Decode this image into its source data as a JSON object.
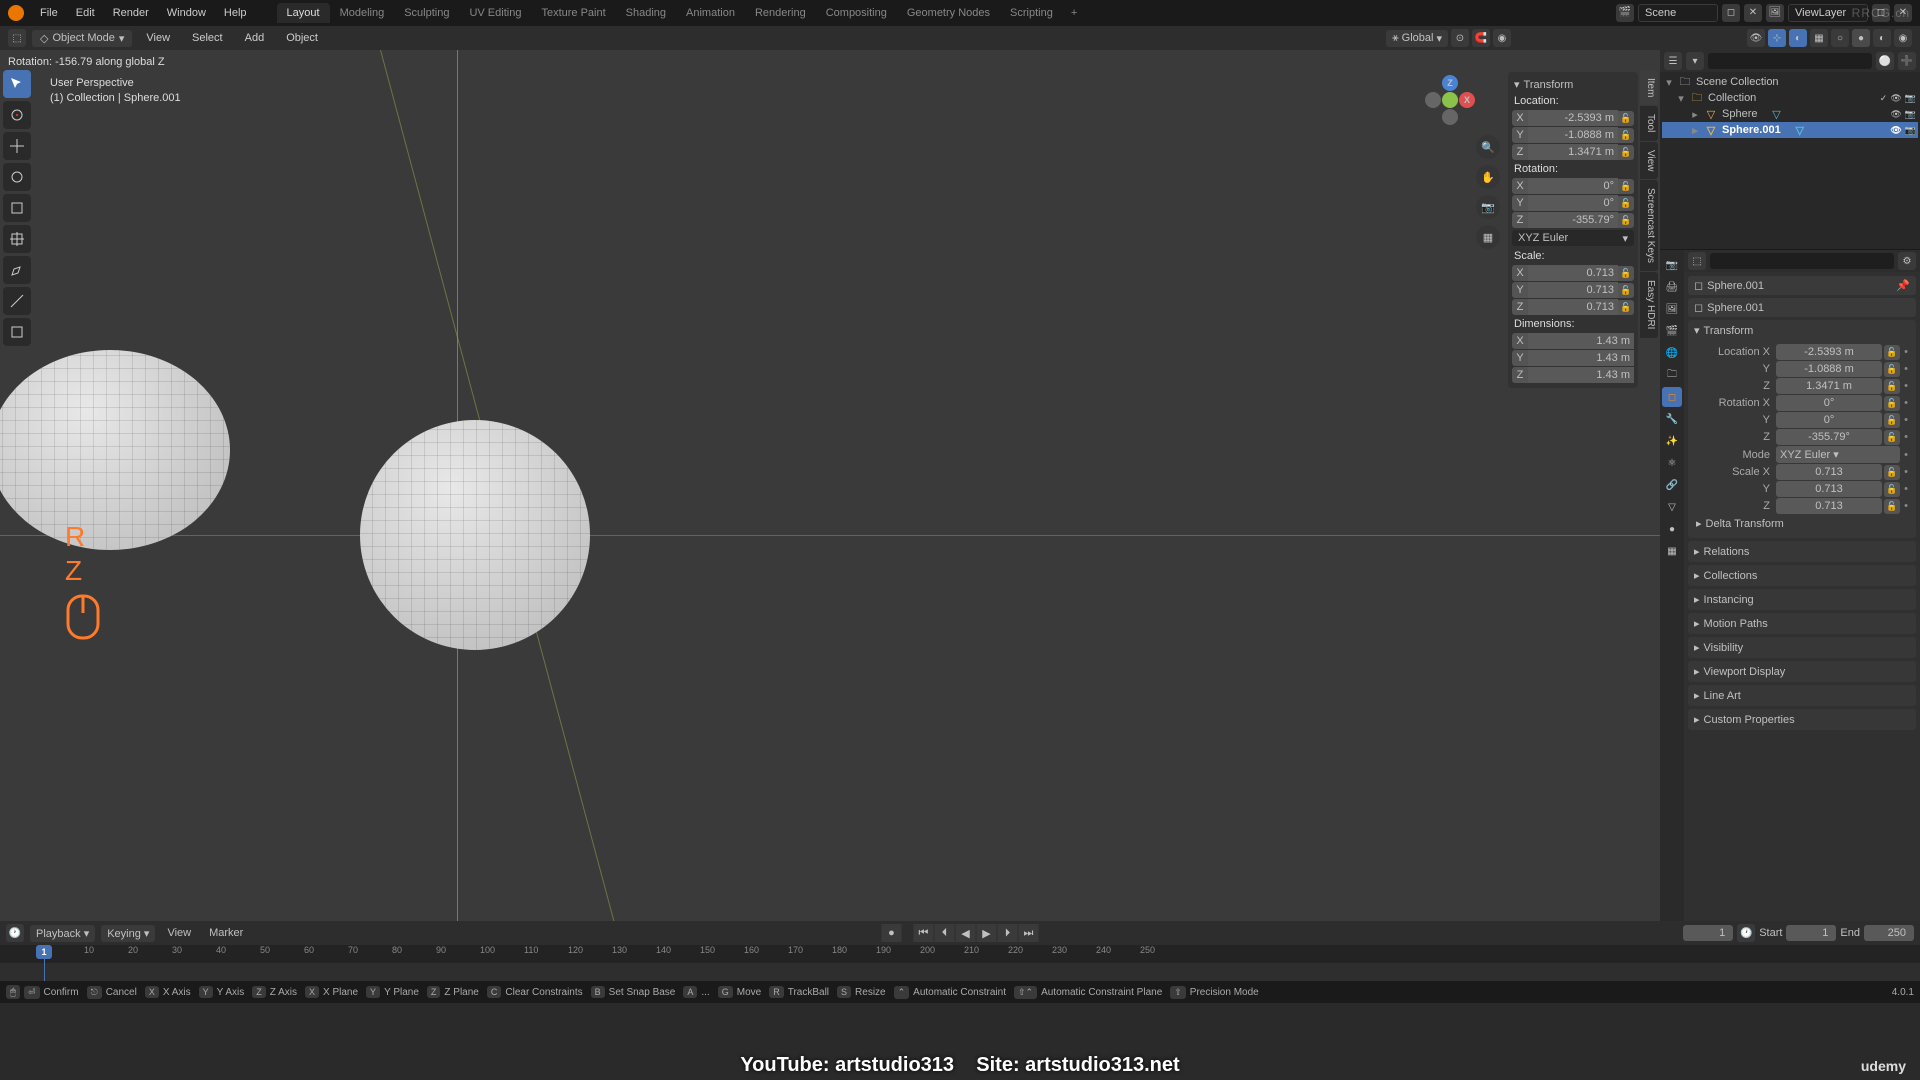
{
  "menubar": {
    "menus": [
      "File",
      "Edit",
      "Render",
      "Window",
      "Help"
    ],
    "workspaces": [
      "Layout",
      "Modeling",
      "Sculpting",
      "UV Editing",
      "Texture Paint",
      "Shading",
      "Animation",
      "Rendering",
      "Compositing",
      "Geometry Nodes",
      "Scripting"
    ],
    "active_workspace": "Layout",
    "scene_label": "Scene",
    "viewlayer_label": "ViewLayer"
  },
  "toolbar": {
    "mode": "Object Mode",
    "menus": [
      "View",
      "Select",
      "Add",
      "Object"
    ],
    "orientation": "Global"
  },
  "viewport": {
    "status_text": "Rotation: -156.79 along global Z",
    "overlay_line1": "User Perspective",
    "overlay_line2": "(1) Collection | Sphere.001",
    "screencast_keys": [
      "R",
      "Z"
    ],
    "n_tabs": [
      "Item",
      "Tool",
      "View",
      "Screencast Keys",
      "Easy HDRI"
    ]
  },
  "n_panel": {
    "header": "Transform",
    "location_label": "Location:",
    "location": {
      "x": "-2.5393 m",
      "y": "-1.0888 m",
      "z": "1.3471 m"
    },
    "rotation_label": "Rotation:",
    "rotation": {
      "x": "0°",
      "y": "0°",
      "z": "-355.79°"
    },
    "rotation_mode": "XYZ Euler",
    "scale_label": "Scale:",
    "scale": {
      "x": "0.713",
      "y": "0.713",
      "z": "0.713"
    },
    "dimensions_label": "Dimensions:",
    "dimensions": {
      "x": "1.43 m",
      "y": "1.43 m",
      "z": "1.43 m"
    }
  },
  "outliner": {
    "root": "Scene Collection",
    "collection": "Collection",
    "items": [
      {
        "name": "Sphere",
        "selected": false
      },
      {
        "name": "Sphere.001",
        "selected": true
      }
    ]
  },
  "properties": {
    "breadcrumb1": "Sphere.001",
    "breadcrumb2": "Sphere.001",
    "transform_header": "Transform",
    "loc_label": "Location X",
    "loc": {
      "x": "-2.5393 m",
      "y": "-1.0888 m",
      "z": "1.3471 m"
    },
    "rot_label": "Rotation X",
    "rot": {
      "x": "0°",
      "y": "0°",
      "z": "-355.79°"
    },
    "mode_label": "Mode",
    "mode_value": "XYZ Euler",
    "scale_label": "Scale X",
    "scale": {
      "x": "0.713",
      "y": "0.713",
      "z": "0.713"
    },
    "panels": [
      "Delta Transform",
      "Relations",
      "Collections",
      "Instancing",
      "Motion Paths",
      "Visibility",
      "Viewport Display",
      "Line Art",
      "Custom Properties"
    ]
  },
  "timeline": {
    "menus": [
      "Playback",
      "Keying",
      "View",
      "Marker"
    ],
    "current": "1",
    "start_label": "Start",
    "start": "1",
    "end_label": "End",
    "end": "250",
    "ticks": [
      "1",
      "10",
      "20",
      "30",
      "40",
      "50",
      "60",
      "70",
      "80",
      "90",
      "100",
      "110",
      "120",
      "130",
      "140",
      "150",
      "160",
      "170",
      "180",
      "190",
      "200",
      "210",
      "220",
      "230",
      "240",
      "250"
    ]
  },
  "statusbar": {
    "hints": [
      {
        "key": "⏎",
        "label": "Confirm"
      },
      {
        "key": "⎋",
        "label": "Cancel"
      },
      {
        "key": "X",
        "label": "X Axis"
      },
      {
        "key": "Y",
        "label": "Y Axis"
      },
      {
        "key": "Z",
        "label": "Z Axis"
      },
      {
        "key": "X",
        "label": "X Plane"
      },
      {
        "key": "Y",
        "label": "Y Plane"
      },
      {
        "key": "Z",
        "label": "Z Plane"
      },
      {
        "key": "C",
        "label": "Clear Constraints"
      },
      {
        "key": "B",
        "label": "Set Snap Base"
      },
      {
        "key": "A",
        "label": "..."
      },
      {
        "key": "G",
        "label": "Move"
      },
      {
        "key": "R",
        "label": "TrackBall"
      },
      {
        "key": "S",
        "label": "Resize"
      },
      {
        "key": "⌃",
        "label": "Automatic Constraint"
      },
      {
        "key": "⇧⌃",
        "label": "Automatic Constraint Plane"
      },
      {
        "key": "⇧",
        "label": "Precision Mode"
      }
    ],
    "version": "4.0.1"
  },
  "footer": {
    "youtube": "YouTube: artstudio313",
    "site": "Site: artstudio313.net",
    "udemy": "udemy"
  },
  "watermark": "RRCG.cn"
}
